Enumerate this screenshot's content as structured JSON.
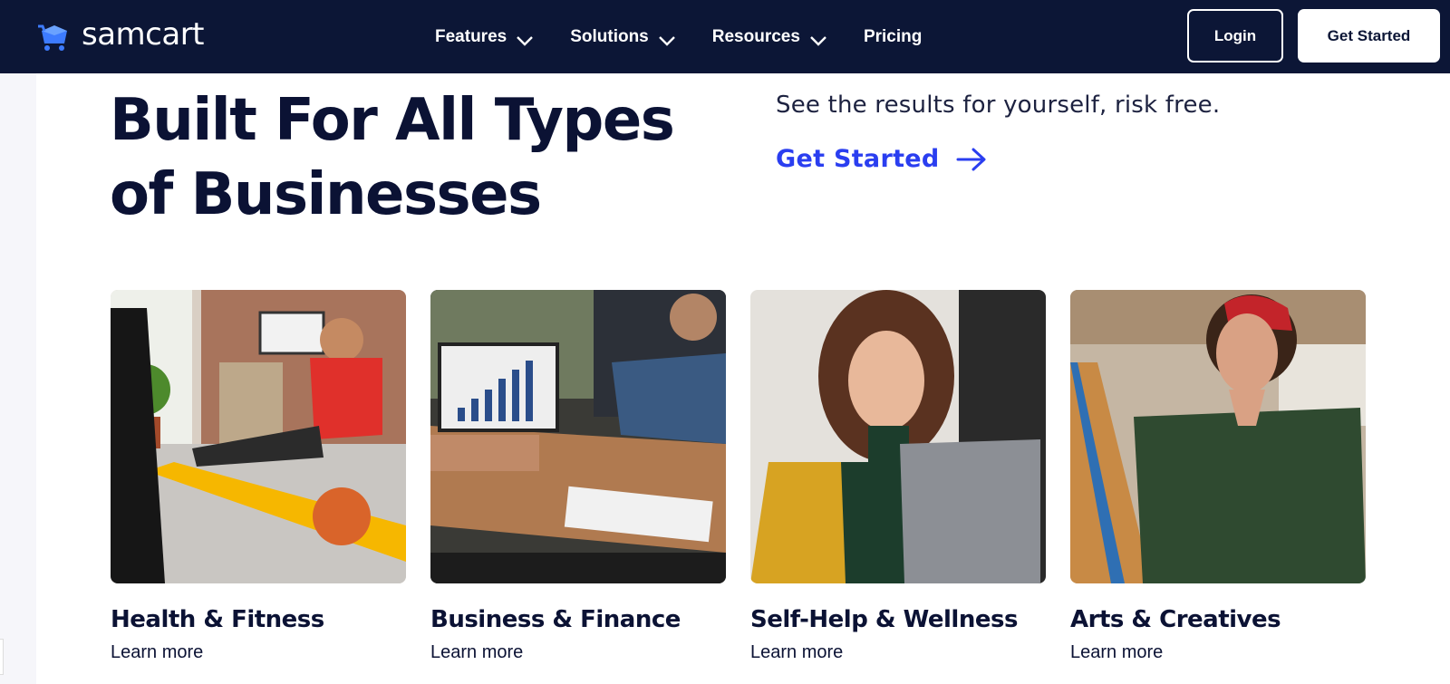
{
  "brand": {
    "name": "samcart",
    "accent": "#2a3ef0",
    "nav_bg": "#0c1636"
  },
  "nav": {
    "items": [
      {
        "label": "Features",
        "has_dropdown": true
      },
      {
        "label": "Solutions",
        "has_dropdown": true
      },
      {
        "label": "Resources",
        "has_dropdown": true
      },
      {
        "label": "Pricing",
        "has_dropdown": false
      }
    ],
    "login_label": "Login",
    "get_started_label": "Get Started"
  },
  "hero": {
    "headline_line1": "Built For All Types",
    "headline_line2": "of Businesses",
    "tagline": "See the results for yourself, risk free.",
    "cta_label": "Get Started"
  },
  "cards": [
    {
      "title": "Health & Fitness",
      "link": "Learn more",
      "image": "man-exercising-photo"
    },
    {
      "title": "Business & Finance",
      "link": "Learn more",
      "image": "business-meeting-photo"
    },
    {
      "title": "Self-Help & Wellness",
      "link": "Learn more",
      "image": "woman-laptop-photo"
    },
    {
      "title": "Arts & Creatives",
      "link": "Learn more",
      "image": "woman-painting-photo"
    }
  ]
}
